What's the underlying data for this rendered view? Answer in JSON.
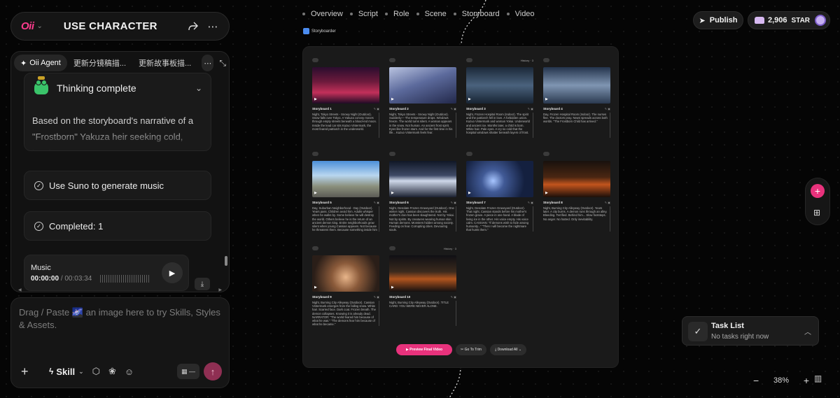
{
  "app": {
    "logo": "Oii",
    "title": "USE CHARACTER"
  },
  "agent_tabs": [
    {
      "label": "Oii Agent"
    },
    {
      "label": "更新分镜稿描..."
    },
    {
      "label": "更新故事板描..."
    }
  ],
  "thinking": {
    "title": "Thinking complete",
    "body": "Based on the storyboard's narrative of a \"Frostborn\" Yakuza heir seeking cold, inevita"
  },
  "steps": [
    {
      "label": "Use Suno to generate music"
    },
    {
      "label": "Completed: 1"
    }
  ],
  "music": {
    "label": "Music",
    "current": "00:00:00",
    "total": "/ 00:03:34"
  },
  "composer": {
    "placeholder": "Drag / Paste 🌌 an image here to try Skills, Styles & Assets.",
    "skill_label": "Skill"
  },
  "nav": [
    "Overview",
    "Script",
    "Role",
    "Scene",
    "Storyboard",
    "Video"
  ],
  "storyboarder_tag": "Storyboarder",
  "storyboards": [
    {
      "name": "Storyboard 1",
      "history": "",
      "desc": "Night, Tokyo Streets - Snowy Night (Outdoor). Snow falls over Tokyo. A Yakuza convoy moves through empty streets beneath a blood-red moon. Inside the lead car sits Kazuo Vintermark, the most feared patriarch in the underworld."
    },
    {
      "name": "Storyboard 2",
      "history": "",
      "desc": "Night, Tokyo Streets - Snowy Night (Outdoor). Suddenly— The temperature drops. Windows freeze. The world turns silent. A woman appears in the snow. Not human. An ancient frost spirit. Eyes like frozen stars. And for the first time in his life... Kazuo Vintermark feels fear."
    },
    {
      "name": "Storyboard 3",
      "history": "History · 3",
      "desc": "Night, Frozen Hospital Room (Indoor). The spirit and the patriarch fell in love. A forbidden union. Kazuo Vintermark and woman Yokai. Underworld and ancient ice. Months later, a child is born. White hair. Pale eyes. A cry so cold that the hospital windows shatter beneath layers of frost."
    },
    {
      "name": "Storyboard 4",
      "history": "",
      "desc": "Day, Frozen Hospital Room (Indoor). The nurses flee. The doctors pray. News spreads across both worlds. \"The Frostborn Child has arrived.\""
    },
    {
      "name": "Storyboard 5",
      "history": "",
      "desc": "Day, Suburban Neighborhood - Day (Outdoor). Years pass. Children avoid him. Adults whisper when he walks by. Some believe he will destroy the world. Others believe he is the return of an ancient demon king. Entire neighborhoods grow silent when young Cassian appears. Not because he threatens them. Because something inside him"
    },
    {
      "name": "Storyboard 6",
      "history": "",
      "desc": "Night, Desolate Frozen Graveyard (Outdoor). One winter night, Cassian discovers the truth. His mother's clan has been slaughtered. Not by Yokai. Not by spirits. By creatures wearing human skin. Human demons. Monsters hidden among society. Feeding on fear. Corrupting cities. Devouring souls."
    },
    {
      "name": "Storyboard 7",
      "history": "",
      "desc": "Night, Desolate Frozen Graveyard (Outdoor). That night, Cassian stands before his mother's frozen grave. A piece in one hand. A blade of living ice in the other. His voice empty. His voice calm. CASSIAN: \"If demons wish to hide among humanity...\" \"Then I will become the nightmare that hunts them.\""
    },
    {
      "name": "Storyboard 8",
      "history": "",
      "desc": "Night, Burning City Alleyway (Outdoor). Years later. A city burns. A demon runs through an alley. Bleeding. Terrified. Behind him... Slow footsteps. No anger. No hatred. Only inevitability."
    },
    {
      "name": "Storyboard 9",
      "history": "",
      "desc": "Night, Burning City Alleyway (Outdoor). Cassian Vintermark emerges from the falling snow. White hair. Scarred face. Dark coat. Frozen breath. The demon collapses. Knowing it is already dead. NARRATOR: \"The world feared him because of what he was.\" \"The demons fear him because of what he became.\""
    },
    {
      "name": "Storyboard 10",
      "history": "History · 3",
      "desc": "Night, Burning City Alleyway (Outdoor). TITLE CARD: YOU WERE NEVER ALONE."
    }
  ],
  "board_buttons": {
    "preview": "Preview Final Video",
    "trim": "Go To Trim",
    "download": "Download All"
  },
  "header_right": {
    "publish": "Publish",
    "star_count": "2,906",
    "star_label": "STAR"
  },
  "task_list": {
    "title": "Task List",
    "subtitle": "No tasks right now"
  },
  "zoom": {
    "level": "38%"
  }
}
